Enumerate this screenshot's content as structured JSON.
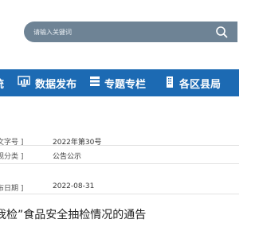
{
  "search": {
    "placeholder": "请输入关键词"
  },
  "nav": {
    "items": [
      {
        "label": "统"
      },
      {
        "label": "数据发布"
      },
      {
        "label": "专题专栏"
      },
      {
        "label": "各区县局"
      }
    ]
  },
  "info": [
    {
      "label": "文字号 ]",
      "value": "2022年第30号"
    },
    {
      "label": "规分类 ]",
      "value": "公告公示"
    },
    {
      "label": "布日期 ]",
      "value": "2022-08-31"
    }
  ],
  "doc": {
    "title": "我检”食品安全抽检情况的通告"
  },
  "colors": {
    "nav_bg": "#1c6ab3",
    "search_bg": "#6e8395"
  }
}
